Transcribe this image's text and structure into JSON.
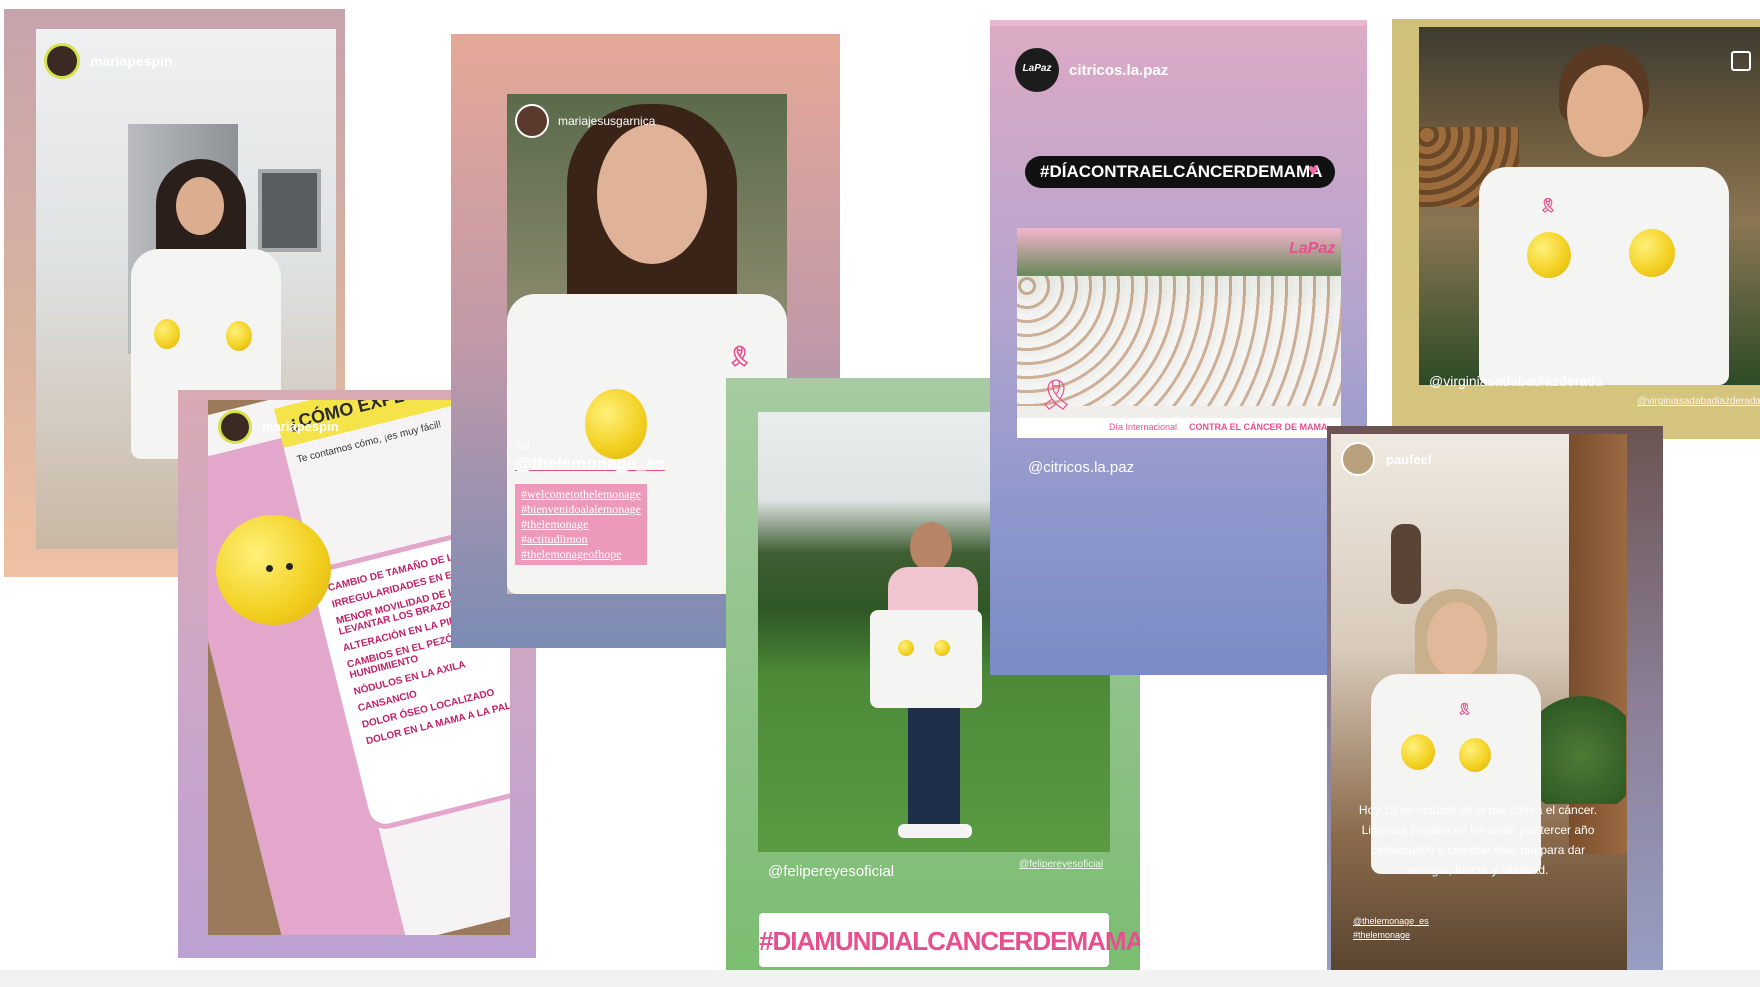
{
  "stories": {
    "mariapespin_1": {
      "username": "mariapespin"
    },
    "mariapespin_2": {
      "username": "mariapespin",
      "heading": "¿CÓMO EXPLORAR TUS LI",
      "intro": "Te contamos cómo, ¡es muy fácil!",
      "list": [
        "CAMBIO DE TAMAÑO DE LAS MAMAS",
        "IRREGULARIDADES EN EL CONTORNO",
        "MENOR MOVILIDAD DE LAS MAMAS AL LEVANTAR LOS BRAZOS",
        "ALTERACIÓN EN LA PIEL DE LA MAMA",
        "CAMBIOS EN EL PEZÓN, COMO HUNDIMIENTO",
        "NÓDULOS EN LA AXILA",
        "CANSANCIO",
        "DOLOR ÓSEO LOCALIZADO",
        "DOLOR EN LA MAMA A LA PALPACIÓN"
      ]
    },
    "mariajesusgarnica": {
      "username": "mariajesusgarnica",
      "ad_label": "Ad",
      "mention": "@thelemonage_es",
      "hashtags": [
        "#welcometothelemonage",
        "#bienvenidoalalemonage",
        "#thelemonage",
        "#actitudlimon",
        "#thelemonageofhope"
      ]
    },
    "felipereyes": {
      "mention": "@felipereyesoficial",
      "small_tag": "@felipereyesoficial",
      "banner": "#DIAMUNDIALCANCERDEMAMA"
    },
    "citricos": {
      "username": "citricos.la.paz",
      "logo_text": "LaPaz",
      "hashtag": "#DÍACONTRAELCÁNCERDEMAMA",
      "photo_logo": "LaPaz",
      "caption_prefix": "Día Internacional",
      "caption_bold": "CONTRA EL CÁNCER DE MAMA",
      "mention": "@citricos.la.paz"
    },
    "virginia": {
      "mention": "@virginiasadabadiazderada",
      "small_tag": "@virginiasadabadiazderada"
    },
    "paufeel": {
      "username": "paufeel",
      "caption": "Hoy 19 de octubre es el día contra el cáncer. Limones España se ha unido por tercer año consecutivo a celebrar este día para dar energía, fuerza y vitalidad.",
      "small_tags": [
        "@thelemonage_es",
        "#thelemonage"
      ]
    }
  },
  "colors": {
    "pink": "#e84f8f",
    "lemon": "#f2cf1e"
  }
}
